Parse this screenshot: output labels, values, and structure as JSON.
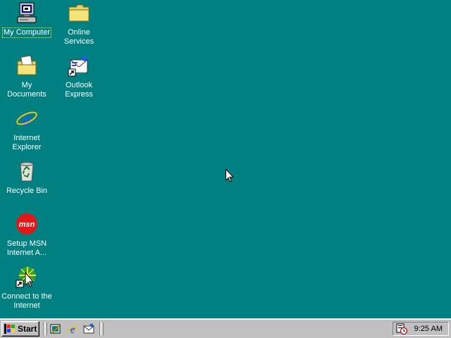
{
  "desktop": {
    "background": "#008080",
    "icons": [
      {
        "label": "My Computer",
        "icon": "my-computer-icon",
        "selected": true
      },
      {
        "label": "Online\nServices",
        "icon": "folder-icon"
      },
      {
        "label": "My Documents",
        "icon": "my-documents-icon"
      },
      {
        "label": "Outlook\nExpress",
        "icon": "outlook-express-icon"
      },
      {
        "label": "Internet\nExplorer",
        "icon": "internet-explorer-icon"
      },
      {
        "label": "Recycle Bin",
        "icon": "recycle-bin-icon"
      },
      {
        "label": "Setup MSN\nInternet A...",
        "icon": "msn-icon",
        "badge": "msn"
      },
      {
        "label": "Connect to the\nInternet",
        "icon": "connect-internet-icon"
      }
    ]
  },
  "taskbar": {
    "start_label": "Start",
    "quick_launch": [
      "show-desktop-icon",
      "internet-explorer-icon",
      "outlook-express-icon"
    ],
    "tray": {
      "icons": [
        "scheduler-icon"
      ],
      "clock": "9:25 AM"
    }
  }
}
